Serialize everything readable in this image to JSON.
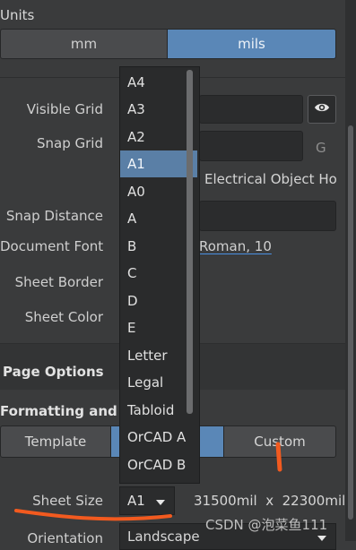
{
  "units": {
    "title": "Units",
    "options": [
      "mm",
      "mils"
    ],
    "selected": "mils"
  },
  "grid": {
    "visible_grid_label": "Visible Grid",
    "snap_grid_label": "Snap Grid",
    "snap_grid_hotkey": "G",
    "electrical_object_text": "Electrical Object Ho",
    "snap_distance_label": "Snap Distance",
    "document_font_label": "Document Font",
    "document_font_value": "Roman, 10",
    "sheet_border_label": "Sheet Border",
    "sheet_color_label": "Sheet Color"
  },
  "page_options": {
    "title": "Page Options",
    "formatting_title": "Formatting and Si",
    "tabs": [
      "Template",
      "",
      "Custom"
    ],
    "sheet_size_label": "Sheet Size",
    "sheet_size_value": "A1",
    "sheet_dimensions": "31500mil  x  22300mil",
    "orientation_label": "Orientation",
    "orientation_value": "Landscape"
  },
  "dropdown": {
    "items": [
      "A4",
      "A3",
      "A2",
      "A1",
      "A0",
      "A",
      "B",
      "C",
      "D",
      "E",
      "Letter",
      "Legal",
      "Tabloid",
      "OrCAD A",
      "OrCAD B"
    ],
    "selected": "A1"
  },
  "watermark": "CSDN @泡菜鱼111",
  "colors": {
    "accent": "#5a87b7",
    "annotation": "#f25a1f"
  }
}
